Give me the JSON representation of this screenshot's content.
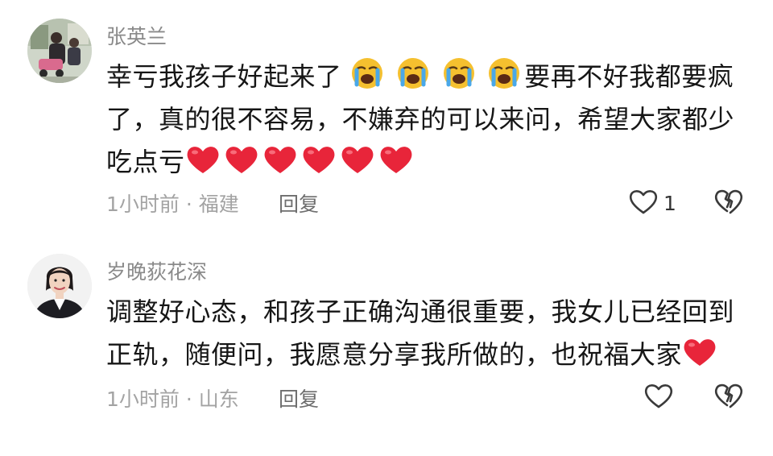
{
  "comments": [
    {
      "username": "张英兰",
      "lines": [
        {
          "text_a": "幸亏我孩子好起来了",
          "text_b": "要再不好我都要疯"
        },
        {
          "text": "了，真的很不容易，不嫌弃的可以来问，希望大家都少"
        },
        {
          "text": "吃点亏"
        }
      ],
      "emoji_crying": "loudly-crying-face-emoji",
      "emoji_heart": "red-heart-emoji",
      "time": "1小时前",
      "location": "福建",
      "meta": "1小时前 · 福建",
      "reply_label": "回复",
      "like_count": "1",
      "like_icon": "heart-outline-icon",
      "dislike_icon": "broken-heart-icon"
    },
    {
      "username": "岁晚荻花深",
      "lines": [
        {
          "text": "调整好心态，和孩子正确沟通很重要，我女儿已经回到"
        },
        {
          "text": "正轨，随便问，我愿意分享我所做的，也祝福大家"
        }
      ],
      "emoji_heart": "red-heart-emoji",
      "time": "1小时前",
      "location": "山东",
      "meta": "1小时前 · 山东",
      "reply_label": "回复",
      "like_icon": "heart-outline-icon",
      "dislike_icon": "broken-heart-icon"
    }
  ],
  "colors": {
    "username": "#8a8a8a",
    "body": "#161616",
    "meta": "#a3a3a3",
    "reply": "#6e6e6e",
    "heart_red": "#e8253a",
    "emoji_yellow": "#f5c02f",
    "tear_blue": "#4aa8e8"
  }
}
